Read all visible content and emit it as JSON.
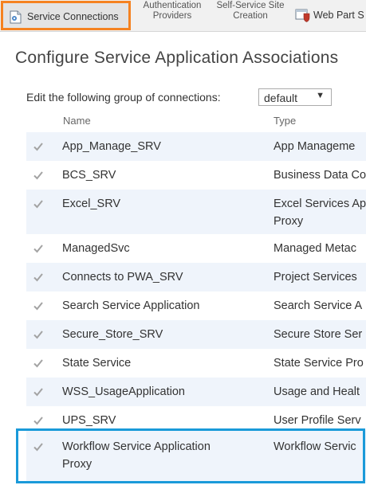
{
  "ribbon": {
    "active_label": "Service Connections",
    "auth_line1": "Authentication",
    "auth_line2": "Providers",
    "ssc_line1": "Self-Service Site",
    "ssc_line2": "Creation",
    "webpart_label": "Web Part S"
  },
  "page_title": "Configure Service Application Associations",
  "edit_label": "Edit the following group of connections:",
  "group_select": {
    "value": "default"
  },
  "columns": {
    "name": "Name",
    "type": "Type"
  },
  "rows": [
    {
      "name": "App_Manage_SRV",
      "type": "App Manageme"
    },
    {
      "name": "BCS_SRV",
      "type": "Business Data Co"
    },
    {
      "name": "Excel_SRV",
      "type": "Excel Services Ap",
      "type2": "Proxy"
    },
    {
      "name": "ManagedSvc",
      "type": "Managed Metac"
    },
    {
      "name": "Connects to PWA_SRV",
      "type": "Project Services"
    },
    {
      "name": "Search Service Application",
      "type": "Search Service A"
    },
    {
      "name": "Secure_Store_SRV",
      "type": "Secure Store Ser"
    },
    {
      "name": "State Service",
      "type": "State Service Pro"
    },
    {
      "name": "WSS_UsageApplication",
      "type": "Usage and Healt"
    },
    {
      "name": "UPS_SRV",
      "type": "User Profile Serv"
    },
    {
      "name": "Workflow Service Application",
      "name2": "Proxy",
      "type": "Workflow Servic"
    }
  ],
  "colors": {
    "active_outline": "#f58220",
    "highlight_outline": "#1a9ad9",
    "row_alt": "#eff4fb"
  }
}
